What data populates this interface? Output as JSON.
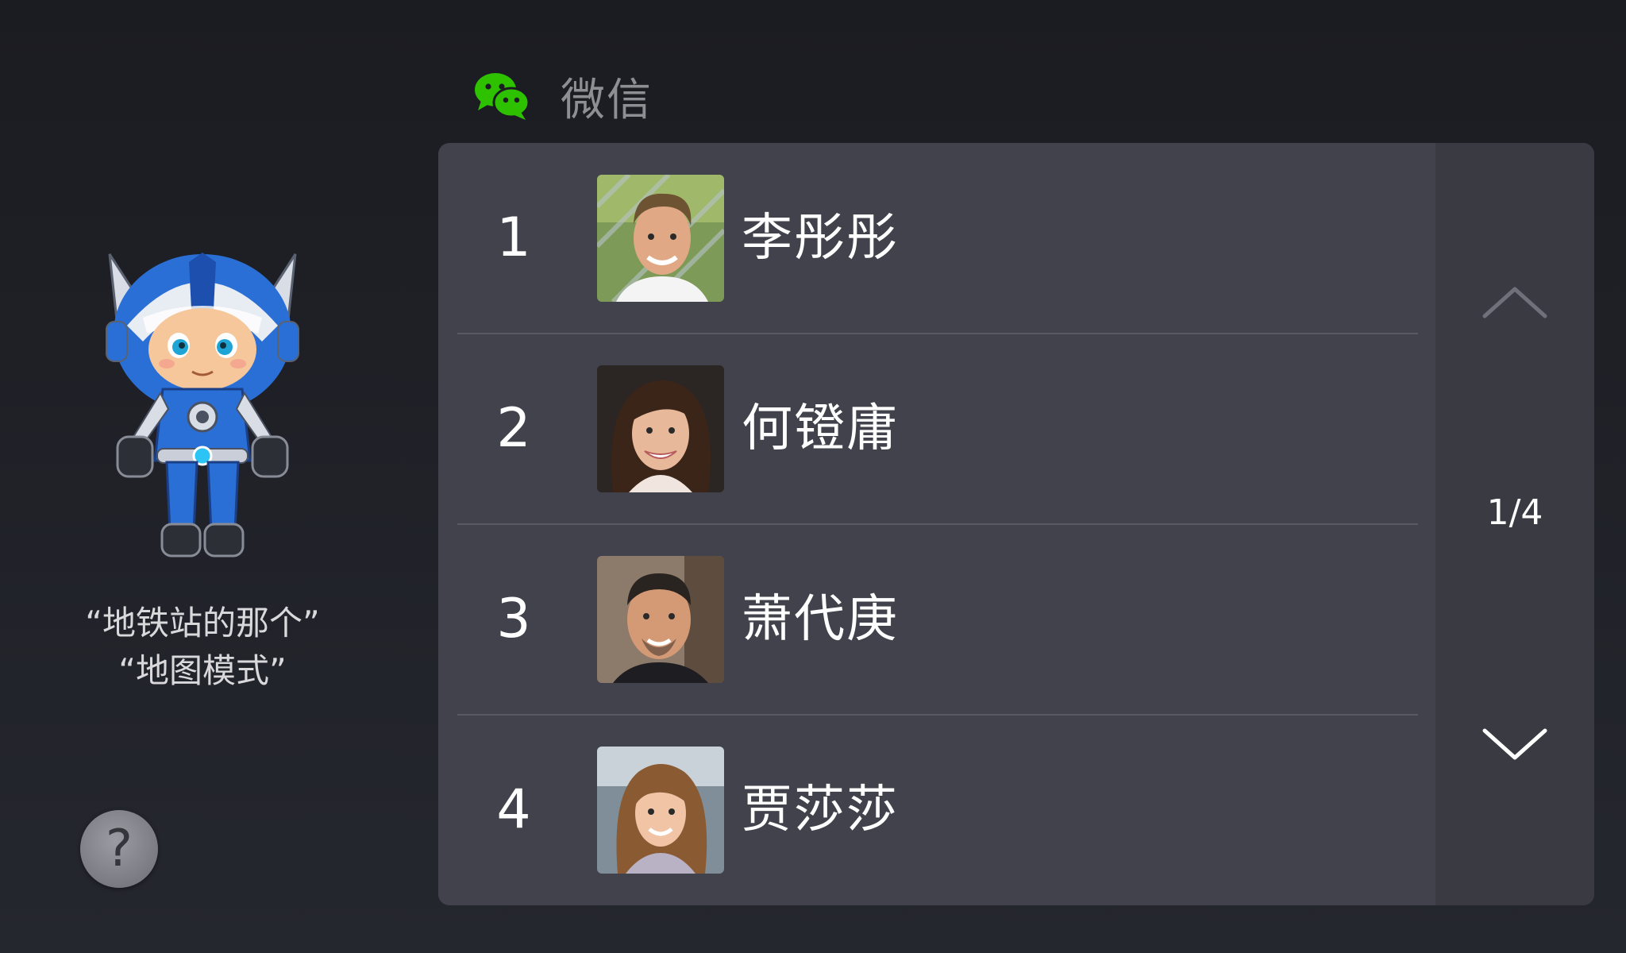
{
  "header": {
    "title": "微信",
    "icon": "wechat-icon",
    "accent": "#2dc100"
  },
  "assistant": {
    "hint_lines": [
      "“地铁站的那个”",
      "“地图模式”"
    ],
    "help_label": "?"
  },
  "contacts": [
    {
      "index": "1",
      "name": "李彤彤"
    },
    {
      "index": "2",
      "name": "何镫庸"
    },
    {
      "index": "3",
      "name": "萧代庚"
    },
    {
      "index": "4",
      "name": "贾莎莎"
    }
  ],
  "pager": {
    "page_label": "1/4",
    "up_icon": "chevron-up-icon",
    "down_icon": "chevron-down-icon"
  }
}
